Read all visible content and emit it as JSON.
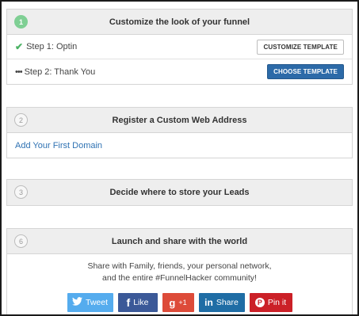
{
  "panel1": {
    "number": "1",
    "title": "Customize the look of your funnel",
    "steps": [
      {
        "status_icon": "✔",
        "label": "Step 1: Optin",
        "button": "CUSTOMIZE TEMPLATE"
      },
      {
        "status_icon": "•••",
        "label": "Step 2: Thank You",
        "button": "CHOOSE TEMPLATE"
      }
    ]
  },
  "panel2": {
    "number": "2",
    "title": "Register a Custom Web Address",
    "link": "Add Your First Domain"
  },
  "panel3": {
    "number": "3",
    "title": "Decide where to store your Leads"
  },
  "panel6": {
    "number": "6",
    "title": "Launch and share with the world",
    "text_line1": "Share with Family, friends, your personal network,",
    "text_line2": "and the entire #FunnelHacker community!",
    "share_buttons": [
      {
        "icon": "twitter-bird",
        "glyph": "🐦",
        "label": "Tweet",
        "color": "#55acee"
      },
      {
        "icon": "facebook-f",
        "glyph": "f",
        "label": "Like",
        "color": "#3b5998"
      },
      {
        "icon": "google-plus",
        "glyph": "g",
        "label": "+1",
        "color": "#dd4b39"
      },
      {
        "icon": "linkedin-in",
        "glyph": "in",
        "label": "Share",
        "color": "#1f6da5"
      },
      {
        "icon": "pinterest-p",
        "glyph": "P",
        "label": "Pin it",
        "color": "#cb2027"
      }
    ]
  },
  "colors": {
    "check_green": "#4bb264",
    "step_done_circle": "#7fcf94",
    "primary_button": "#2c6aa8",
    "link": "#2f72b3"
  }
}
